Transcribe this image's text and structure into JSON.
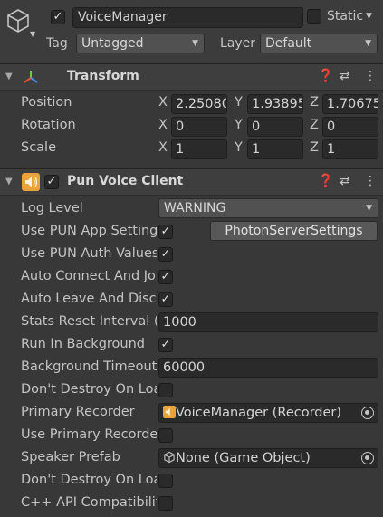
{
  "header": {
    "object_name": "VoiceManager",
    "static_label": "Static",
    "tag_label": "Tag",
    "tag_value": "Untagged",
    "layer_label": "Layer",
    "layer_value": "Default",
    "active_check": "✓"
  },
  "transform": {
    "title": "Transform",
    "position_label": "Position",
    "rotation_label": "Rotation",
    "scale_label": "Scale",
    "axes": [
      "X",
      "Y",
      "Z"
    ],
    "position": [
      "2.25080",
      "1.93895",
      "1.70675"
    ],
    "rotation": [
      "0",
      "0",
      "0"
    ],
    "scale": [
      "1",
      "1",
      "1"
    ]
  },
  "pun_voice_client": {
    "title": "Pun Voice Client",
    "enabled_check": "✓",
    "rows": {
      "log_level": {
        "label": "Log Level",
        "value": "WARNING"
      },
      "use_pun_app_settings": {
        "label": "Use PUN App Settings",
        "check": "✓",
        "button": "PhotonServerSettings"
      },
      "use_pun_auth_values": {
        "label": "Use PUN Auth Values",
        "check": "✓"
      },
      "auto_connect": {
        "label": "Auto Connect And Join",
        "check": "✓"
      },
      "auto_leave": {
        "label": "Auto Leave And Disconnect",
        "check": "✓"
      },
      "stats_reset": {
        "label": "Stats Reset Interval (",
        "value": "1000"
      },
      "run_in_background": {
        "label": "Run In Background",
        "check": "✓"
      },
      "background_timeout": {
        "label": "Background Timeout",
        "value": "60000"
      },
      "dont_destroy_1": {
        "label": "Don't Destroy On Load",
        "check": ""
      },
      "primary_recorder": {
        "label": "Primary Recorder",
        "value": "VoiceManager (Recorder)"
      },
      "use_primary_recorder": {
        "label": "Use Primary Recorder",
        "check": ""
      },
      "speaker_prefab": {
        "label": "Speaker Prefab",
        "value": "None (Game Object)"
      },
      "dont_destroy_2": {
        "label": "Don't Destroy On Load",
        "check": ""
      },
      "cpp_api": {
        "label": "C++ API Compatibility",
        "check": ""
      }
    }
  },
  "colors": {
    "background": "#383838",
    "field": "#2a2a2a",
    "text": "#c4c4c4",
    "accent_orange": "#e8a33a"
  }
}
